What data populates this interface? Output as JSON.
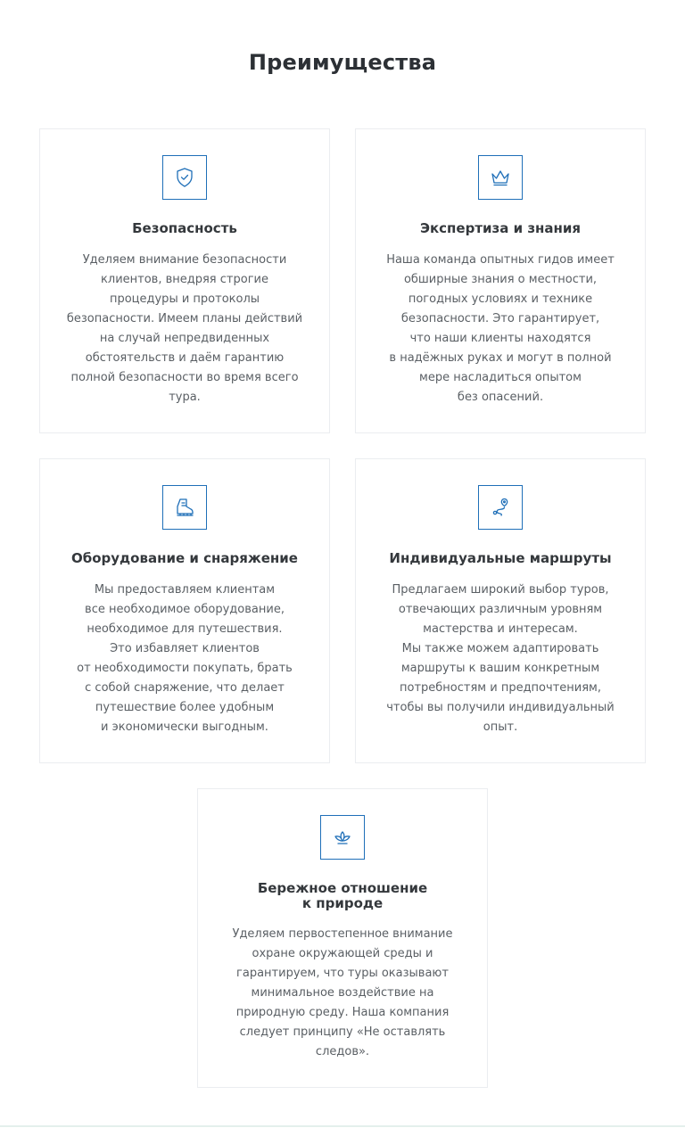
{
  "section": {
    "title": "Преимущества"
  },
  "colors": {
    "accent": "#1f6fb8",
    "card_border": "#ebedf0",
    "title": "#2c3035",
    "text": "#5a5f64"
  },
  "cards": [
    {
      "icon": "shield-check-icon",
      "title": "Безопасность",
      "text": "Уделяем внимание безопасности\nклиентов, внедряя строгие\nпроцедуры и протоколы\nбезопасности. Имеем планы действий\nна случай непредвиденных\nобстоятельств и даём гарантию\nполной безопасности во время всего\nтура."
    },
    {
      "icon": "crown-icon",
      "title": "Экспертиза и знания",
      "text": "Наша команда опытных гидов имеет\nобширные знания о местности,\nпогодных условиях и технике\nбезопасности. Это гарантирует,\nчто наши клиенты находятся\nв надёжных руках и могут в полной\nмере насладиться опытом\nбез опасений."
    },
    {
      "icon": "hiking-boot-icon",
      "title": "Оборудование и снаряжение",
      "text": "Мы предоставляем клиентам\nвсе необходимое оборудование,\nнеобходимое для путешествия.\nЭто избавляет клиентов\nот необходимости покупать, брать\nс собой снаряжение, что делает\nпутешествие более удобным\nи экономически выгодным."
    },
    {
      "icon": "route-pin-icon",
      "title": "Индивидуальные маршруты",
      "text": "Предлагаем широкий выбор туров,\nотвечающих различным уровням\nмастерства и интересам.\nМы также можем адаптировать\nмаршруты к вашим конкретным\nпотребностям и предпочтениям,\nчтобы вы получили индивидуальный\nопыт."
    },
    {
      "icon": "lotus-icon",
      "title": "Бережное отношение\nк природе",
      "text": "Уделяем первостепенное внимание\nохране окружающей среды и\nгарантируем, что туры оказывают\nминимальное воздействие на\nприродную среду. Наша компания\nследует принципу «Не оставлять\nследов»."
    }
  ]
}
